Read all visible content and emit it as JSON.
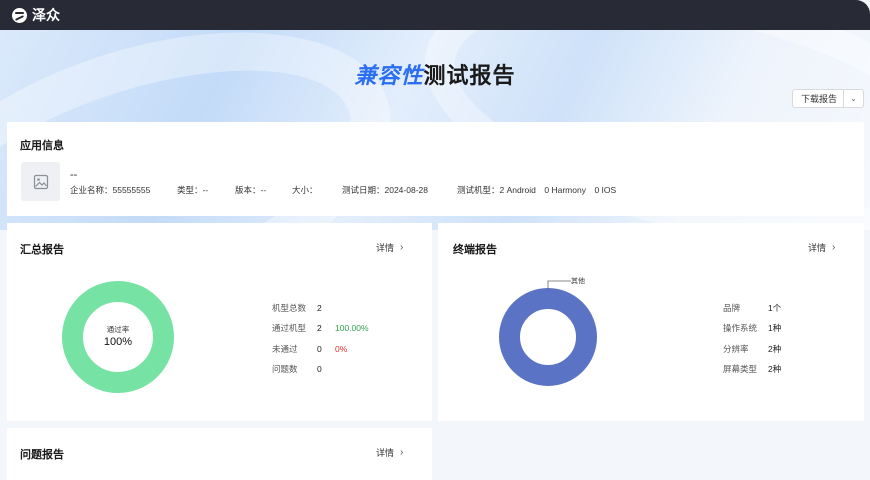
{
  "app": {
    "brand": "泽众"
  },
  "header": {
    "title_highlight": "兼容性",
    "title_rest": "测试报告",
    "download_label": "下载报告"
  },
  "app_info": {
    "title": "应用信息",
    "app_name": "--",
    "company": "企业名称：55555555",
    "type": "类型：--",
    "version": "版本：--",
    "size": "大小：",
    "test_date": "测试日期：2024-08-28",
    "test_devices": "测试机型：2 Android　0 Harmony　0 IOS"
  },
  "summary": {
    "title": "汇总报告",
    "detail_label": "详情",
    "donut_label": "通过率",
    "donut_value": "100%",
    "pass_fraction": 1.0,
    "stats": [
      {
        "label": "机型总数",
        "value": "2",
        "extra": ""
      },
      {
        "label": "通过机型",
        "value": "2",
        "extra": "100.00%"
      },
      {
        "label": "未通过",
        "value": "0",
        "extra": "0%"
      },
      {
        "label": "问题数",
        "value": "0",
        "extra": ""
      }
    ],
    "colors": {
      "ring": "#76e2a3",
      "pass_text": "#2ea44f",
      "fail_text": "#e03131"
    }
  },
  "terminal": {
    "title": "终端报告",
    "detail_label": "详情",
    "slice_label": "其他",
    "stats": [
      {
        "label": "品牌",
        "value": "1个"
      },
      {
        "label": "操作系统",
        "value": "1种"
      },
      {
        "label": "分辨率",
        "value": "2种"
      },
      {
        "label": "屏幕类型",
        "value": "2种"
      }
    ],
    "colors": {
      "ring": "#5b73c4"
    }
  },
  "issues": {
    "title": "问题报告",
    "detail_label": "详情"
  }
}
